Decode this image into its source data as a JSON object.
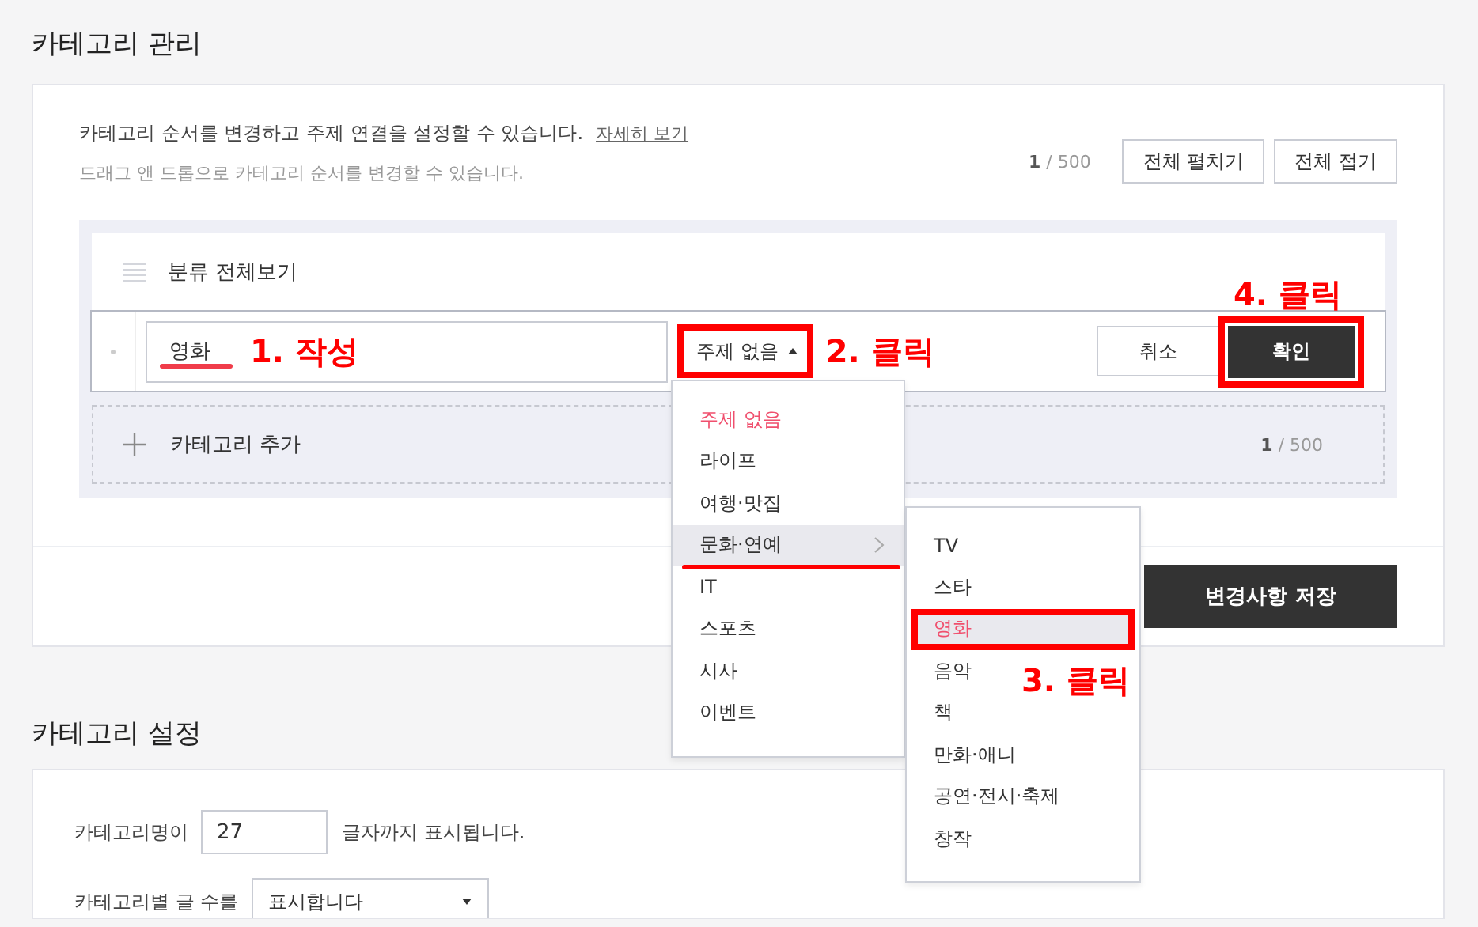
{
  "category_management": {
    "title": "카테고리 관리",
    "description": "카테고리 순서를 변경하고 주제 연결을 설정할 수 있습니다.",
    "help_link": "자세히 보기",
    "hint": "드래그 앤 드롭으로 카테고리 순서를 변경할 수 있습니다.",
    "counter": "**1** / 500",
    "buttons": [
      "전체 펼치기",
      "전체 접기"
    ]
  },
  "category_list": {
    "header_item": "분류 전체보기",
    "editing_item": {
      "value": "영화",
      "underlined": true,
      "note": "1. 작성",
      "topic_button": {
        "label": "주제 없음",
        "expanded": true,
        "note": "2. 클릭"
      },
      "cancel": "취소",
      "confirm": {
        "label": "확인",
        "note": "4. 클릭"
      }
    },
    "add_item": {
      "label": "카테고리 추가",
      "counter": "**1** / 500"
    }
  },
  "topic_menu": [
    {
      "label": "주제 없음",
      "selected": true,
      "highlighted": false,
      "underlined": false
    },
    {
      "label": "라이프",
      "selected": false,
      "highlighted": false,
      "underlined": false
    },
    {
      "label": "여행·맛집",
      "selected": false,
      "highlighted": false,
      "underlined": false
    },
    {
      "label": "문화·연예",
      "selected": false,
      "highlighted": true,
      "underlined": true,
      "children": [
        {
          "label": "TV",
          "selected": false,
          "highlighted": false
        },
        {
          "label": "스타",
          "selected": false,
          "highlighted": false
        },
        {
          "label": "영화",
          "selected": true,
          "highlighted": true,
          "note": "3. 클릭"
        },
        {
          "label": "음악",
          "selected": false,
          "highlighted": false
        },
        {
          "label": "책",
          "selected": false,
          "highlighted": false
        },
        {
          "label": "만화·애니",
          "selected": false,
          "highlighted": false
        },
        {
          "label": "공연·전시·축제",
          "selected": false,
          "highlighted": false
        },
        {
          "label": "창작",
          "selected": false,
          "highlighted": false
        }
      ]
    },
    {
      "label": "IT",
      "selected": false,
      "highlighted": false,
      "underlined": false
    },
    {
      "label": "스포츠",
      "selected": false,
      "highlighted": false,
      "underlined": false
    },
    {
      "label": "시사",
      "selected": false,
      "highlighted": false,
      "underlined": false
    },
    {
      "label": "이벤트",
      "selected": false,
      "highlighted": false,
      "underlined": false
    }
  ],
  "save_button": "변경사항 저장",
  "category_settings": {
    "title": "카테고리 설정",
    "name_length": {
      "label": "카테고리명이",
      "value": "27",
      "suffix": "글자까지 표시됩니다."
    },
    "post_count": {
      "label": "카테고리별 글 수를",
      "value": "표시합니다"
    }
  }
}
